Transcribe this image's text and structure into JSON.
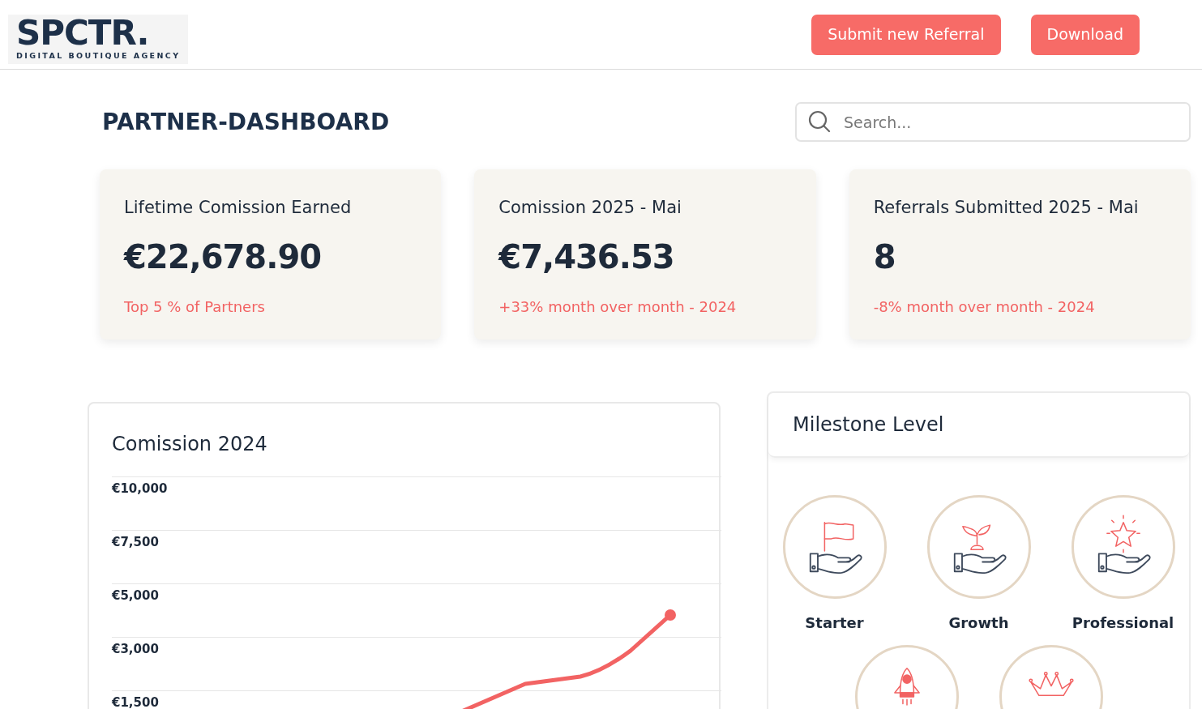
{
  "header": {
    "logo": {
      "wordmark": "SPCTR.",
      "tagline": "DIGITAL BOUTIQUE AGENCY"
    },
    "buttons": [
      "Submit new Referral",
      "Download"
    ]
  },
  "page_title": "PARTNER-DASHBOARD",
  "search": {
    "placeholder": "Search..."
  },
  "stats": [
    {
      "title": "Lifetime Comission Earned",
      "value": "€22,678.90",
      "note": "Top 5 % of Partners"
    },
    {
      "title": "Comission 2025 - Mai",
      "value": "€7,436.53",
      "note": "+33% month over month - 2024"
    },
    {
      "title": "Referrals Submitted 2025 - Mai",
      "value": "8",
      "note": "-8% month over month - 2024"
    }
  ],
  "commission_chart": {
    "title": "Comission 2024",
    "y_axis_labels": [
      "€10,000",
      "€7,500",
      "€5,000",
      "€3,000",
      "€1,500"
    ]
  },
  "milestones": {
    "title": "Milestone Level",
    "levels": [
      {
        "kind": "flag",
        "label": "Starter"
      },
      {
        "kind": "sprout",
        "label": "Growth"
      },
      {
        "kind": "star",
        "label": "Professional"
      },
      {
        "kind": "rocket"
      },
      {
        "kind": "crown"
      }
    ]
  }
}
